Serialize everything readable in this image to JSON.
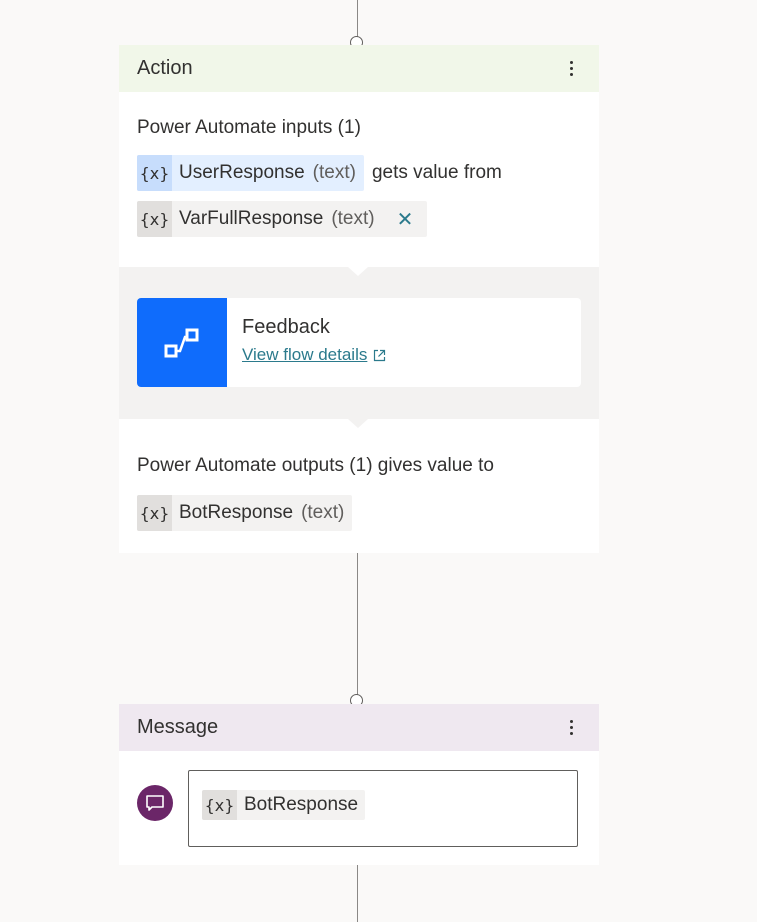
{
  "action_card": {
    "title": "Action",
    "more_label": "More options",
    "inputs_label": "Power Automate inputs (1)",
    "input_variable": {
      "icon": "{x}",
      "name": "UserResponse",
      "type": "(text)"
    },
    "gets_value_from": "gets value from",
    "source_variable": {
      "icon": "{x}",
      "name": "VarFullResponse",
      "type": "(text)"
    },
    "remove_icon": "✕",
    "flow": {
      "name": "Feedback",
      "link_label": "View flow details",
      "icon_color": "#0f6cfc"
    },
    "outputs_label": "Power Automate outputs (1) gives value to",
    "output_variable": {
      "icon": "{x}",
      "name": "BotResponse",
      "type": "(text)"
    }
  },
  "message_card": {
    "title": "Message",
    "more_label": "More options",
    "message_variable": {
      "icon": "{x}",
      "name": "BotResponse"
    },
    "avatar_color": "#6b2668"
  },
  "colors": {
    "canvas": "#faf9f8",
    "action_header": "#f1f7e9",
    "message_header": "#efe8f0",
    "link": "#2b7a8c"
  }
}
